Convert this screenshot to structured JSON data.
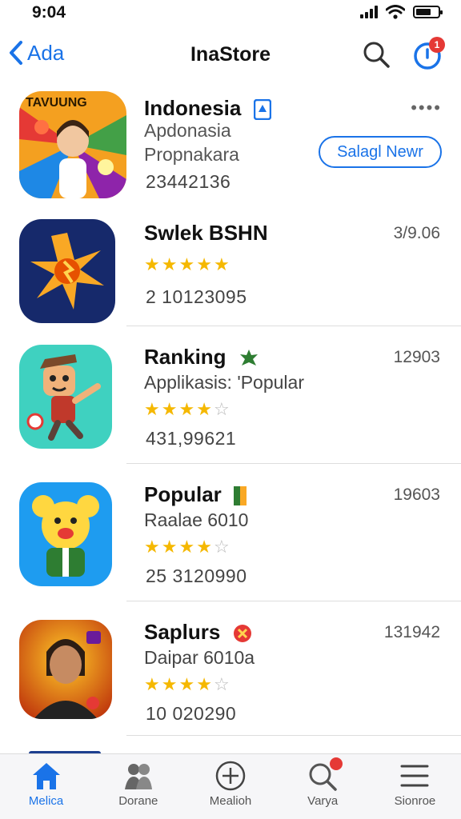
{
  "status": {
    "time": "9:04"
  },
  "nav": {
    "back_label": "Ada",
    "title": "InaStore",
    "notify_count": "1"
  },
  "featured": {
    "name": "Indonesia",
    "icon_text": "TAVUUNG",
    "line1": "Apdonasia",
    "line2": "Propnakara",
    "count": "23442136",
    "action_label": "Salagl  Newr",
    "more_label": "••••"
  },
  "apps": [
    {
      "name": "Swlek BSHN",
      "metric": "3/9.06",
      "subtitle": "",
      "rating": 4.5,
      "count": "2 10123095"
    },
    {
      "name": "Ranking",
      "metric": "12903",
      "subtitle": "Applikasis: 'Popular",
      "rating": 3.5,
      "count": "431,99621"
    },
    {
      "name": "Popular",
      "metric": "19603",
      "subtitle": "Raalae 6010",
      "rating": 4,
      "count": "25 3120990"
    },
    {
      "name": "Saplurs",
      "metric": "131942",
      "subtitle": "Daipar 6010a",
      "rating": 4,
      "count": "10 020290"
    }
  ],
  "tabs": [
    {
      "label": "Melica",
      "icon": "home-icon",
      "active": true
    },
    {
      "label": "Dorane",
      "icon": "people-icon",
      "active": false
    },
    {
      "label": "Mealioh",
      "icon": "plus-circle-icon",
      "active": false
    },
    {
      "label": "Varya",
      "icon": "search-icon",
      "active": false
    },
    {
      "label": "Sionroe",
      "icon": "menu-icon",
      "active": false
    }
  ],
  "colors": {
    "accent": "#1a73e8",
    "star": "#f5b800",
    "badge": "#e53935"
  }
}
